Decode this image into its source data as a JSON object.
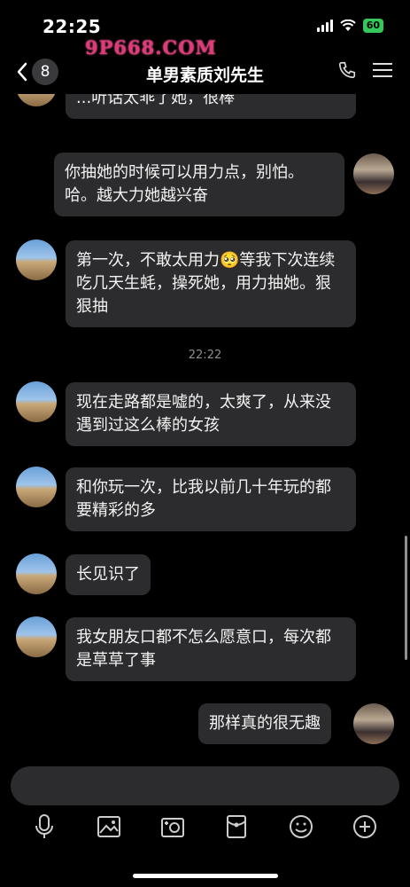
{
  "status_bar": {
    "time": "22:25",
    "battery": "60",
    "watermark": "9P668.COM"
  },
  "nav": {
    "back_count": "8",
    "title": "单男素质刘先生"
  },
  "messages": [
    {
      "side": "left",
      "text": "...听话太乖了她，很棒"
    },
    {
      "side": "right",
      "text": "你抽她的时候可以用力点，别怕。哈。越大力她越兴奋"
    },
    {
      "side": "left",
      "text": "第一次，不敢太用力🥺等我下次连续吃几天生蚝，操死她，用力抽她。狠狠抽"
    },
    {
      "side": "left",
      "text": "现在走路都是嘘的，太爽了，从来没遇到过这么棒的女孩"
    },
    {
      "side": "left",
      "text": "和你玩一次，比我以前几十年玩的都要精彩的多"
    },
    {
      "side": "left",
      "text": "长见识了"
    },
    {
      "side": "left",
      "text": "我女朋友口都不怎么愿意口，每次都是草草了事"
    },
    {
      "side": "right",
      "text": "那样真的很无趣"
    }
  ],
  "timestamp": "22:22",
  "composer": {
    "placeholder": ""
  },
  "toolbar": [
    "microphone-icon",
    "image-icon",
    "camera-icon",
    "red-packet-icon",
    "emoji-icon",
    "plus-icon"
  ]
}
